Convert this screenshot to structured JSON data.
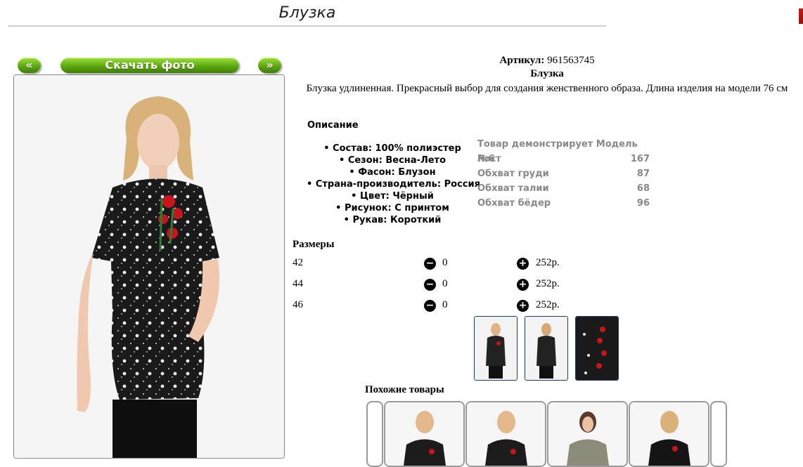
{
  "page": {
    "title": "Блузка"
  },
  "gallery": {
    "prev_label": "«",
    "next_label": "»",
    "download_label": "Скачать фото"
  },
  "product": {
    "article_label": "Артикул:",
    "article_value": "961563745",
    "name": "Блузка",
    "description": "Блузка удлиненная. Прекрасный выбор для создания женственного образа. Длина изделия на модели 76 см"
  },
  "specs": {
    "heading": "Описание",
    "items": [
      "Состав: 100% полиэстер",
      "Сезон: Весна-Лето",
      "Фасон: Блузон",
      "Страна-производитель: Россия",
      "Цвет: Чёрный",
      "Рисунок: С принтом",
      "Рукав: Короткий"
    ]
  },
  "model": {
    "heading": "Товар демонстрирует Модель №6",
    "rows": [
      {
        "label": "Рост",
        "value": "167"
      },
      {
        "label": "Обхват груди",
        "value": "87"
      },
      {
        "label": "Обхват талии",
        "value": "68"
      },
      {
        "label": "Обхват бёдер",
        "value": "96"
      }
    ]
  },
  "sizes": {
    "heading": "Размеры",
    "rows": [
      {
        "size": "42",
        "qty": "0",
        "price": "252р."
      },
      {
        "size": "44",
        "qty": "0",
        "price": "252р."
      },
      {
        "size": "46",
        "qty": "0",
        "price": "252р."
      }
    ],
    "minus_icon": "minus-circle-icon",
    "plus_icon": "plus-circle-icon"
  },
  "similar": {
    "heading": "Похожие товары"
  },
  "colors": {
    "accent_green": "#5da811",
    "thumb_border": "#1c3e5f"
  }
}
